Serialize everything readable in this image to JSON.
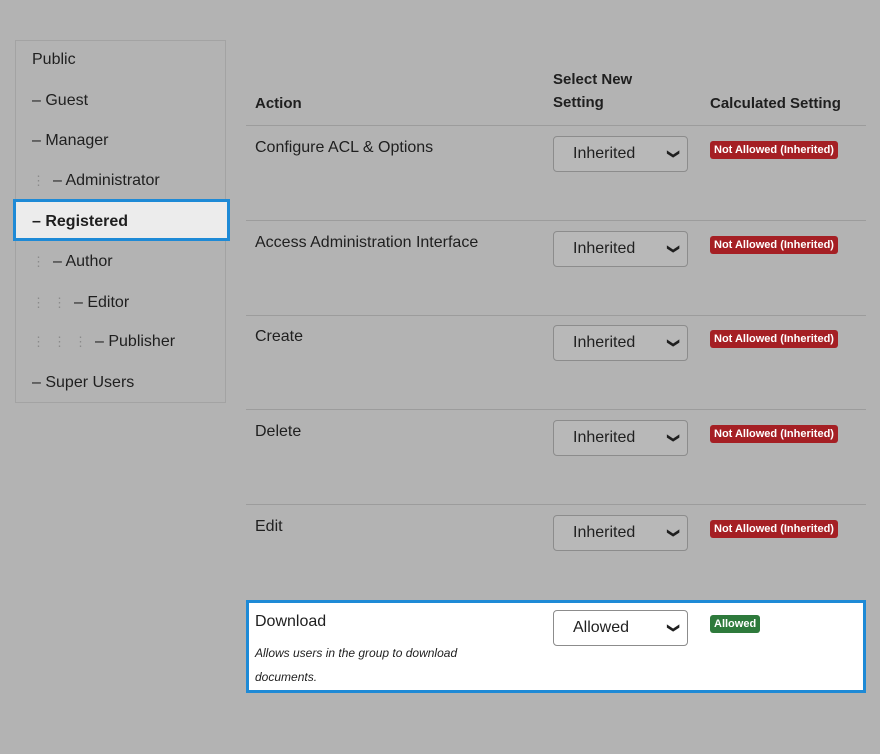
{
  "groups": [
    {
      "label": "Public"
    },
    {
      "label": "– Guest"
    },
    {
      "label": "– Manager"
    },
    {
      "label": "– Administrator"
    },
    {
      "label": "– Registered"
    },
    {
      "label": "– Author"
    },
    {
      "label": "– Editor"
    },
    {
      "label": "– Publisher"
    },
    {
      "label": "– Super Users"
    }
  ],
  "selected_group": "– Registered",
  "columns": {
    "action": "Action",
    "select_new_setting": "Select New Setting",
    "calculated_setting": "Calculated Setting"
  },
  "rows": [
    {
      "action": "Configure ACL & Options",
      "setting": "Inherited",
      "calculated": "Not Allowed (Inherited)"
    },
    {
      "action": "Access Administration Interface",
      "setting": "Inherited",
      "calculated": "Not Allowed (Inherited)"
    },
    {
      "action": "Create",
      "setting": "Inherited",
      "calculated": "Not Allowed (Inherited)"
    },
    {
      "action": "Delete",
      "setting": "Inherited",
      "calculated": "Not Allowed (Inherited)"
    },
    {
      "action": "Edit",
      "setting": "Inherited",
      "calculated": "Not Allowed (Inherited)"
    },
    {
      "action": "Download",
      "description": "Allows users in the group to download documents.",
      "setting": "Allowed",
      "calculated": "Allowed"
    }
  ],
  "colors": {
    "highlight": "#1e8ad6",
    "not_allowed": "#a51f24",
    "allowed": "#2e7a3c"
  },
  "icons": {
    "select_arrow": "chevron-down-icon",
    "tree_indent": "vertical-dots-icon"
  }
}
